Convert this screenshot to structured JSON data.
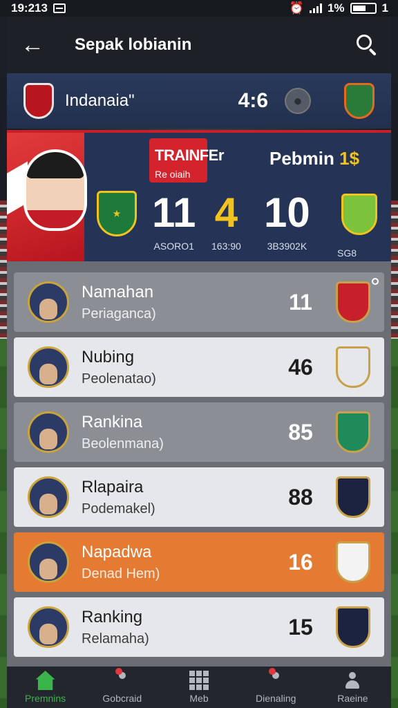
{
  "status": {
    "time": "19:213",
    "battery": "1%",
    "extra": "1"
  },
  "appbar": {
    "back": "←",
    "title": "Sepak lobianin"
  },
  "scorebar": {
    "team": "Indanaia\"",
    "score": "4:6"
  },
  "feature": {
    "tag_title": "TRAINFEr",
    "tag_sub": "Re oiaih",
    "promo_text": "Pebmin",
    "promo_value": "1$",
    "stats": [
      {
        "value": "11",
        "label": "ASORO1"
      },
      {
        "value": "4",
        "label": "163:90"
      },
      {
        "value": "10",
        "label": "3B3902K"
      },
      {
        "value": "",
        "label": "SG8"
      }
    ]
  },
  "players": [
    {
      "name": "Namahan",
      "sub": "Periaganca)",
      "value": "11",
      "style": "grey",
      "club_color": "#c8202a"
    },
    {
      "name": "Nubing",
      "sub": "Peolenatao)",
      "value": "46",
      "style": "light",
      "club_color": "#e6e7ea"
    },
    {
      "name": "Rankina",
      "sub": "Beolenmana)",
      "value": "85",
      "style": "grey",
      "club_color": "#1f8a5a"
    },
    {
      "name": "Rlapaira",
      "sub": "Podemakel)",
      "value": "88",
      "style": "light",
      "club_color": "#1c2340"
    },
    {
      "name": "Napadwa",
      "sub": "Denad Hem)",
      "value": "16",
      "style": "orange",
      "club_color": "#f3f3f3"
    },
    {
      "name": "Ranking",
      "sub": "Relamaha)",
      "value": "15",
      "style": "light",
      "club_color": "#1c2340"
    }
  ],
  "nav": [
    {
      "label": "Premnins",
      "active": true
    },
    {
      "label": "Gobcraid",
      "active": false
    },
    {
      "label": "Meb",
      "active": false
    },
    {
      "label": "Dienaling",
      "active": false
    },
    {
      "label": "Raeine",
      "active": false
    }
  ],
  "colors": {
    "accent": "#39b54a",
    "red": "#c8202a",
    "gold": "#f2c31d",
    "orange": "#e57a32"
  }
}
